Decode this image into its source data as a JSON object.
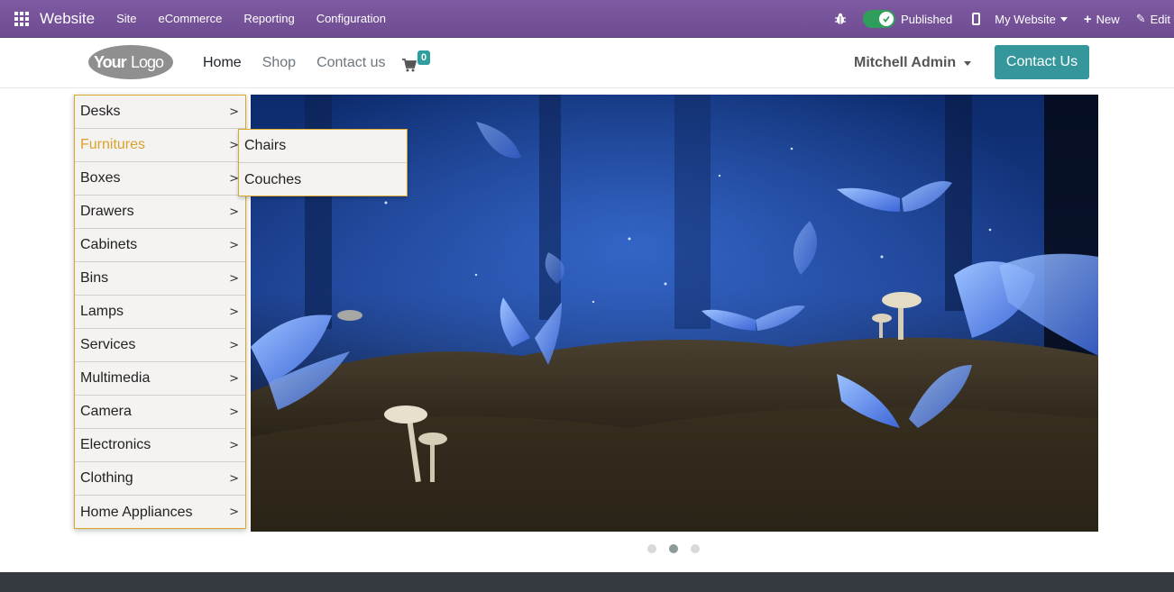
{
  "topbar": {
    "brand": "Website",
    "menu": [
      "Site",
      "eCommerce",
      "Reporting",
      "Configuration"
    ],
    "published_label": "Published",
    "my_website_label": "My Website",
    "new_label": "New",
    "edit_label": "Edit",
    "published_toggle_on": true
  },
  "header": {
    "nav": [
      {
        "label": "Home",
        "active": true
      },
      {
        "label": "Shop",
        "active": false
      },
      {
        "label": "Contact us",
        "active": false
      }
    ],
    "cart_count": "0",
    "user_name": "Mitchell Admin",
    "contact_button": "Contact Us"
  },
  "categories": [
    {
      "label": "Desks",
      "active": false
    },
    {
      "label": "Furnitures",
      "active": true
    },
    {
      "label": "Boxes",
      "active": false
    },
    {
      "label": "Drawers",
      "active": false
    },
    {
      "label": "Cabinets",
      "active": false
    },
    {
      "label": "Bins",
      "active": false
    },
    {
      "label": "Lamps",
      "active": false
    },
    {
      "label": "Services",
      "active": false
    },
    {
      "label": "Multimedia",
      "active": false
    },
    {
      "label": "Camera",
      "active": false
    },
    {
      "label": "Electronics",
      "active": false
    },
    {
      "label": "Clothing",
      "active": false
    },
    {
      "label": "Home Appliances",
      "active": false
    }
  ],
  "submenu": [
    "Chairs",
    "Couches"
  ],
  "carousel": {
    "slide_count": 3,
    "active_index": 1
  },
  "colors": {
    "topbar": "#714b8f",
    "accent": "#35979c",
    "active_category": "#d9a22a",
    "footer": "#343a40"
  }
}
